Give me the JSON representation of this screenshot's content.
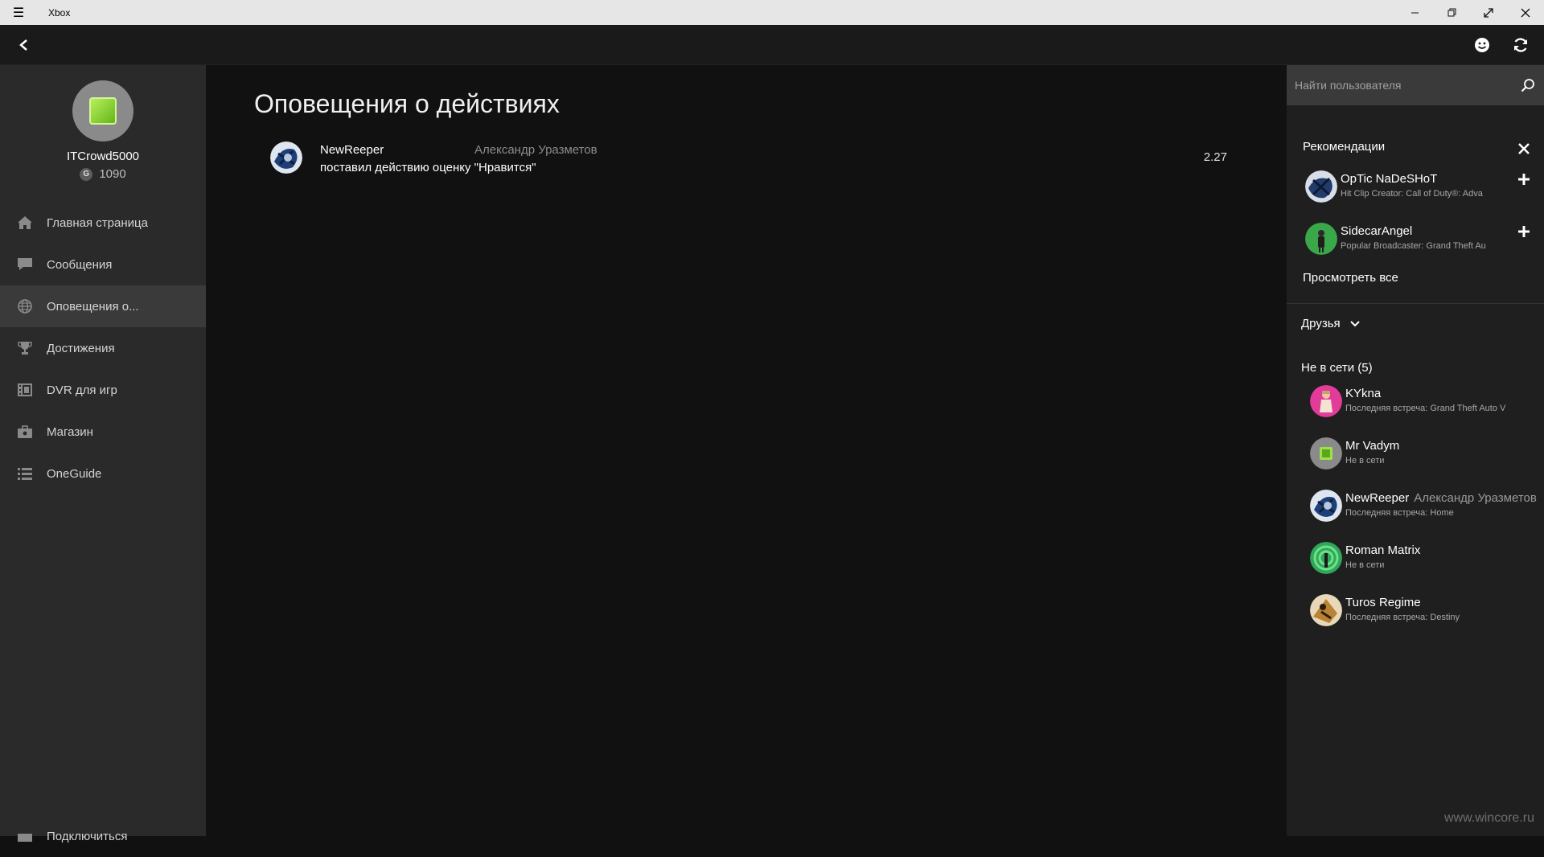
{
  "window": {
    "title": "Xbox"
  },
  "profile": {
    "gamertag": "ITCrowd5000",
    "gamerscore_badge": "G",
    "gamerscore": "1090"
  },
  "nav": {
    "items": [
      {
        "label": "Главная страница",
        "icon": "home-icon"
      },
      {
        "label": "Сообщения",
        "icon": "message-icon"
      },
      {
        "label": "Оповещения о...",
        "icon": "globe-icon",
        "active": true
      },
      {
        "label": "Достижения",
        "icon": "trophy-icon"
      },
      {
        "label": "DVR для игр",
        "icon": "film-icon"
      },
      {
        "label": "Магазин",
        "icon": "bag-icon"
      },
      {
        "label": "OneGuide",
        "icon": "list-icon"
      }
    ],
    "connect_label": "Подключиться"
  },
  "main": {
    "title": "Оповещения о действиях",
    "activity": {
      "gamertag": "NewReeper",
      "real_name": "Александр Уразметов",
      "text": "поставил действию оценку \"Нравится\"",
      "time": "2.27"
    }
  },
  "rpanel": {
    "search_placeholder": "Найти пользователя",
    "recommendations_title": "Рекомендации",
    "recommendations": [
      {
        "name": "OpTic NaDeSHoT",
        "sub": "Hit Clip Creator: Call of Duty®: Adva"
      },
      {
        "name": "SidecarAngel",
        "sub": "Popular Broadcaster: Grand Theft Au"
      }
    ],
    "see_all": "Просмотреть все",
    "friends_label": "Друзья",
    "offline_title": "Не в сети (5)",
    "offline": [
      {
        "name": "KYkna",
        "real": "",
        "sub": "Последняя встреча: Grand Theft Auto V"
      },
      {
        "name": "Mr Vadym",
        "real": "",
        "sub": "Не в сети"
      },
      {
        "name": "NewReeper",
        "real": "Александр Уразметов",
        "sub": "Последняя встреча: Home"
      },
      {
        "name": "Roman Matrix",
        "real": "",
        "sub": "Не в сети"
      },
      {
        "name": "Turos Regime",
        "real": "",
        "sub": "Последняя встреча: Destiny"
      }
    ]
  },
  "watermark": "www.wincore.ru",
  "colors": {
    "sidebar": "#2a2a2a",
    "main": "#111111",
    "rpanel": "#1f1f1f",
    "titlebar": "#e6e6e6"
  }
}
